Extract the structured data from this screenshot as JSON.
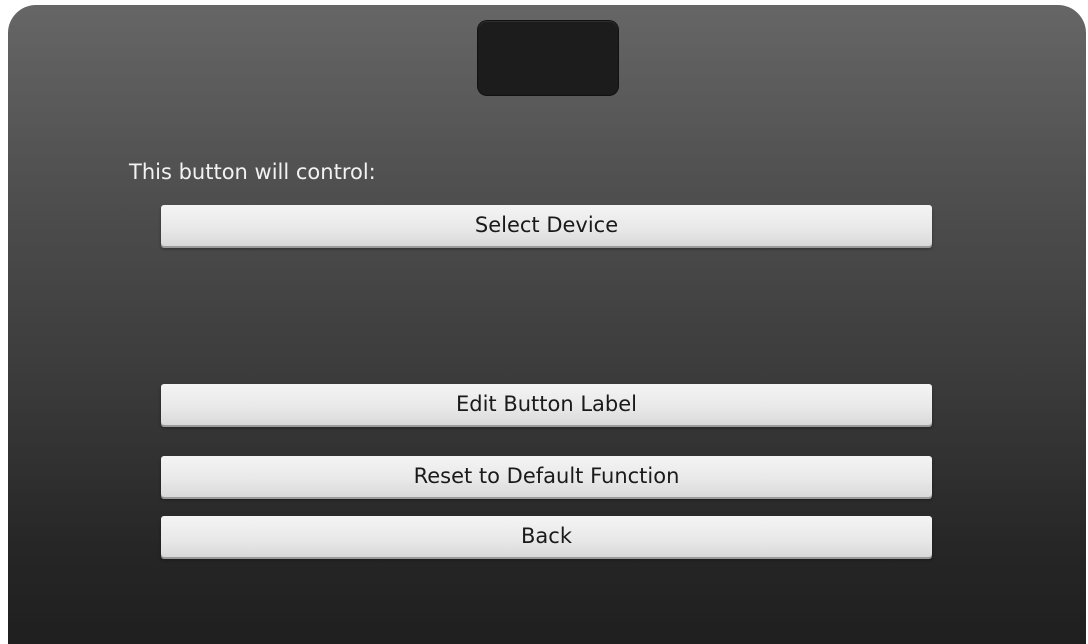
{
  "prompt": "This button will control:",
  "buttons": {
    "select_device": "Select Device",
    "edit_label": "Edit Button Label",
    "reset_default": "Reset to Default Function",
    "back": "Back"
  },
  "device_icon": "remote-button-icon"
}
